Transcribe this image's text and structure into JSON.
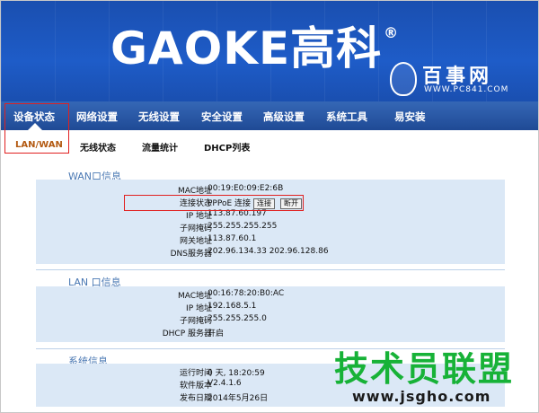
{
  "brand": {
    "logo_text": "GAOKE高科",
    "registered": "®"
  },
  "watermark_top": {
    "cn": "百事网",
    "url": "WWW.PC841.COM"
  },
  "nav": {
    "items": [
      "设备状态",
      "网络设置",
      "无线设置",
      "安全设置",
      "高级设置",
      "系统工具",
      "易安装"
    ],
    "active": "设备状态"
  },
  "subnav": {
    "items": [
      "LAN/WAN",
      "无线状态",
      "流量统计",
      "DHCP列表"
    ],
    "active": "LAN/WAN"
  },
  "wan": {
    "title": "WAN口信息",
    "rows": [
      {
        "label": "MAC地址",
        "value": "00:19:E0:09:E2:6B"
      },
      {
        "label": "连接状态",
        "value": "PPPoE 连接"
      },
      {
        "label": "IP 地址",
        "value": "113.87.60.197"
      },
      {
        "label": "子网掩码",
        "value": "255.255.255.255"
      },
      {
        "label": "网关地址",
        "value": "113.87.60.1"
      },
      {
        "label": "DNS服务器",
        "value": "202.96.134.33 202.96.128.86"
      }
    ],
    "connect_button": "连接",
    "disconnect_button": "断开"
  },
  "lan": {
    "title": "LAN 口信息",
    "rows": [
      {
        "label": "MAC地址",
        "value": "00:16:78:20:B0:AC"
      },
      {
        "label": "IP 地址",
        "value": "192.168.5.1"
      },
      {
        "label": "子网掩码",
        "value": "255.255.255.0"
      },
      {
        "label": "DHCP 服务器",
        "value": "开启"
      }
    ]
  },
  "system": {
    "title": "系统信息",
    "rows": [
      {
        "label": "运行时间",
        "value": "0 天, 18:20:59"
      },
      {
        "label": "软件版本",
        "value": "V2.4.1.6"
      },
      {
        "label": "发布日期",
        "value": "2014年5月26日"
      }
    ]
  },
  "watermark_bottom": {
    "cn": "技术员联盟",
    "url": "www.jsgho.com"
  },
  "colors": {
    "header_bg": "#1e5cc8",
    "nav_bg": "#2a57a5",
    "section_bg": "#dbe8f6",
    "highlight": "#e02020",
    "active_sub": "#b35a12",
    "watermark_green": "#17b237"
  }
}
